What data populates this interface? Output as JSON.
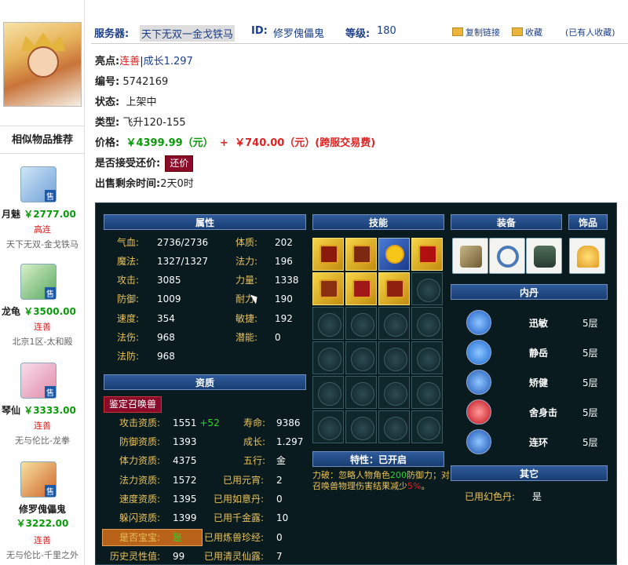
{
  "sidebar": {
    "rec_title": "相似物品推荐",
    "items": [
      {
        "name": "月魅",
        "price": "￥2777.00",
        "flag": "高连",
        "server": "天下无双-金戈铁马"
      },
      {
        "name": "龙龟",
        "price": "￥3500.00",
        "flag": "连善",
        "server": "北京1区-太和殿"
      },
      {
        "name": "琴仙",
        "price": "￥3333.00",
        "flag": "连善",
        "server": "无与伦比-龙拳"
      },
      {
        "name": "修罗傀儡鬼",
        "price": "￥3222.00",
        "flag": "连善",
        "server": "无与伦比-千里之外"
      }
    ],
    "sale_tag": "售"
  },
  "topbar": {
    "server_label": "服务器:",
    "server_value": "天下无双一金戈铁马",
    "id_label": "ID:",
    "id_value": "修罗傀儡鬼",
    "level_label": "等级:",
    "level_value": "180",
    "copy_link": "复制链接",
    "collect": "收藏",
    "collected": "(已有人收藏)"
  },
  "info": {
    "highlight_label": "亮点:",
    "highlight_a": "连善",
    "highlight_sep": "|",
    "highlight_b": "成长1.297",
    "number_label": "编号:",
    "number_value": "5742169",
    "status_label": "状态:",
    "status_value": "上架中",
    "type_label": "类型:",
    "type_value": "飞升120-155",
    "price_label": "价格:",
    "price_value": "￥4399.99（元）",
    "plus": "+",
    "fee_value": "￥740.00（元）(跨服交易费)",
    "bargain_label": "是否接受还价:",
    "bargain_button": "还价",
    "remain_label": "出售剩余时间:",
    "remain_value": "2天0时"
  },
  "panel": {
    "attr_header": "属性",
    "skill_header": "技能",
    "equip_header": "装备",
    "ornament_header": "饰品",
    "neidan_header": "内丹",
    "aptitude_header": "资质",
    "trait_header": "特性：已开启",
    "other_header": "其它",
    "identify_button": "鉴定召唤兽",
    "attrs_left": [
      {
        "k": "气血:",
        "v": "2736/2736"
      },
      {
        "k": "魔法:",
        "v": "1327/1327"
      },
      {
        "k": "攻击:",
        "v": "3085"
      },
      {
        "k": "防御:",
        "v": "1009"
      },
      {
        "k": "速度:",
        "v": "354"
      },
      {
        "k": "法伤:",
        "v": "968"
      },
      {
        "k": "法防:",
        "v": "968"
      }
    ],
    "attrs_right": [
      {
        "k": "体质:",
        "v": "202"
      },
      {
        "k": "法力:",
        "v": "196"
      },
      {
        "k": "力量:",
        "v": "1338"
      },
      {
        "k": "耐力:",
        "v": "190"
      },
      {
        "k": "敏捷:",
        "v": "192"
      },
      {
        "k": "潜能:",
        "v": "0"
      }
    ],
    "apt_left": [
      {
        "k": "攻击资质:",
        "v": "1551",
        "extra": "+52"
      },
      {
        "k": "防御资质:",
        "v": "1393"
      },
      {
        "k": "体力资质:",
        "v": "4375"
      },
      {
        "k": "法力资质:",
        "v": "1572"
      },
      {
        "k": "速度资质:",
        "v": "1395"
      },
      {
        "k": "躲闪资质:",
        "v": "1399"
      },
      {
        "k": "是否宝宝:",
        "v": "是"
      },
      {
        "k": "历史灵性值:",
        "v": "99"
      }
    ],
    "apt_right": [
      {
        "k": "寿命:",
        "v": "9386"
      },
      {
        "k": "成长:",
        "v": "1.297"
      },
      {
        "k": "五行:",
        "v": "金"
      },
      {
        "k": "已用元宵:",
        "v": "2"
      },
      {
        "k": "已用如意丹:",
        "v": "0"
      },
      {
        "k": "已用千金露:",
        "v": "10"
      },
      {
        "k": "已用炼兽珍经:",
        "v": "0"
      },
      {
        "k": "已用清灵仙露:",
        "v": "7"
      }
    ],
    "neidan": [
      {
        "name": "迅敏",
        "level": "5层",
        "color": "#1a5cc8"
      },
      {
        "name": "静岳",
        "level": "5层",
        "color": "#1a6ad0"
      },
      {
        "name": "矫健",
        "level": "5层",
        "color": "#1f58b8"
      },
      {
        "name": "舍身击",
        "level": "5层",
        "color": "#c0101a"
      },
      {
        "name": "连环",
        "level": "5层",
        "color": "#1a4fb0"
      }
    ],
    "trait_text_a": "力破：忽略人物角色",
    "trait_text_num": "200",
    "trait_text_b": "防御力；对召唤兽物理伤害结果减少",
    "trait_text_pct": "5%",
    "trait_text_end": "。",
    "other_label": "已用幻色丹:",
    "other_value": "是"
  }
}
